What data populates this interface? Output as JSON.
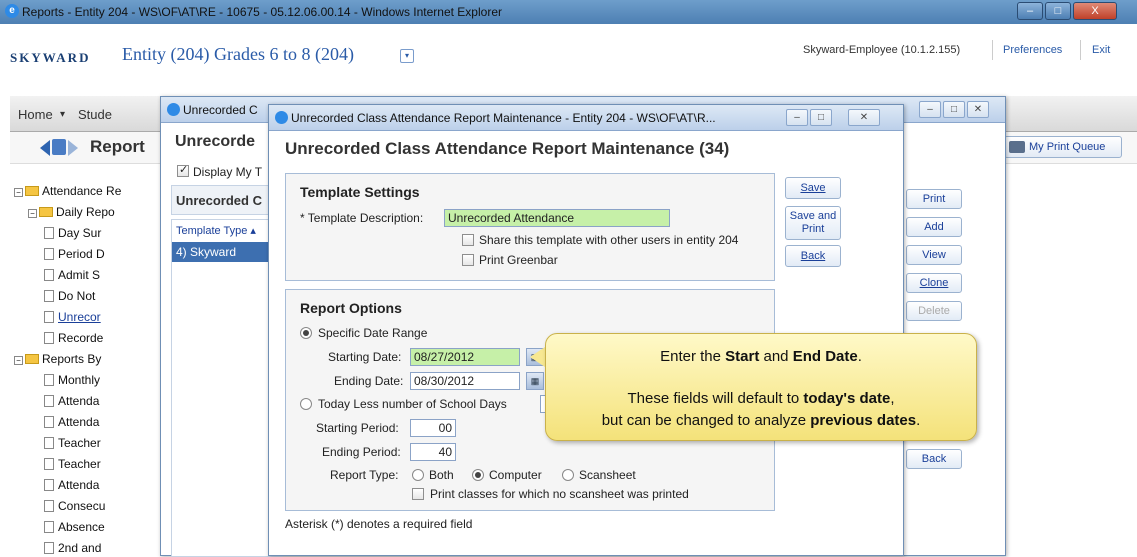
{
  "browser": {
    "title": "Reports - Entity 204 - WS\\OF\\AT\\RE - 10675 - 05.12.06.00.14 - Windows Internet Explorer",
    "controls": {
      "minimize": "–",
      "maximize": "□",
      "close": "X"
    }
  },
  "header": {
    "logo": "SKYWARD",
    "entity": "Entity (204) Grades 6 to 8 (204)",
    "entity_dropdown_glyph": "▾",
    "user": "Skyward-Employee (10.1.2.155)",
    "preferences": "Preferences",
    "exit": "Exit"
  },
  "nav": {
    "home": "Home",
    "home_arrow": "▾",
    "student": "Stude",
    "reports_title": "Report",
    "print_queue": "My Print Queue"
  },
  "tree": {
    "items": [
      {
        "text": "Attendance Re",
        "type": "folder",
        "pm": "−"
      },
      {
        "text": "Daily Repo",
        "type": "folder",
        "pm": "−"
      },
      {
        "text": "Day Sur",
        "type": "doc"
      },
      {
        "text": "Period D",
        "type": "doc"
      },
      {
        "text": "Admit S",
        "type": "doc"
      },
      {
        "text": "Do Not",
        "type": "doc"
      },
      {
        "text": "Unrecor",
        "type": "doc",
        "link": true
      },
      {
        "text": "Recorde",
        "type": "doc"
      },
      {
        "text": "Reports By",
        "type": "folder",
        "pm": "−"
      },
      {
        "text": "Monthly",
        "type": "doc"
      },
      {
        "text": "Attenda",
        "type": "doc"
      },
      {
        "text": "Attenda",
        "type": "doc"
      },
      {
        "text": "Teacher",
        "type": "doc"
      },
      {
        "text": "Teacher",
        "type": "doc"
      },
      {
        "text": "Attenda",
        "type": "doc"
      },
      {
        "text": "Consecu",
        "type": "doc"
      },
      {
        "text": "Absence",
        "type": "doc"
      },
      {
        "text": "2nd and",
        "type": "doc"
      }
    ]
  },
  "mid_window": {
    "title": "Unrecorded C",
    "heading": "Unrecorde",
    "display_my": "Display My T",
    "subheading": "Unrecorded C",
    "col_header": "Template Type ▴",
    "selected_row": "4) Skyward",
    "buttons": [
      "Print",
      "Add",
      "View",
      "Clone",
      "Delete",
      "Back"
    ]
  },
  "dialog": {
    "title": "Unrecorded Class Attendance Report Maintenance - Entity 204 - WS\\OF\\AT\\R...",
    "heading": "Unrecorded Class Attendance Report Maintenance (34)",
    "template_settings": {
      "title": "Template Settings",
      "desc_label": "* Template Description:",
      "desc_value": "Unrecorded Attendance",
      "share_label": "Share this template with other users in entity 204",
      "greenbar_label": "Print Greenbar"
    },
    "buttons": {
      "save": "Save",
      "save_print_1": "Save and",
      "save_print_2": "Print",
      "back": "Back"
    },
    "report_options": {
      "title": "Report Options",
      "specific_range": "Specific Date Range",
      "start_label": "Starting Date:",
      "start_value": "08/27/2012",
      "end_label": "Ending Date:",
      "end_value": "08/30/2012",
      "today_less": "Today Less number of School Days",
      "start_period_label": "Starting Period:",
      "start_period_value": "00",
      "end_period_label": "Ending Period:",
      "end_period_value": "40",
      "report_type_label": "Report Type:",
      "type_both": "Both",
      "type_computer": "Computer",
      "type_scansheet": "Scansheet",
      "print_classes": "Print classes for which no scansheet was printed"
    },
    "footnote": "Asterisk (*) denotes a required field"
  },
  "callout": {
    "line1_a": "Enter the ",
    "line1_b": "Start",
    "line1_c": " and ",
    "line1_d": "End Date",
    "line1_e": ".",
    "line2_a": "These fields will default to ",
    "line2_b": "today's date",
    "line2_c": ",",
    "line3_a": "but can be changed to analyze ",
    "line3_b": "previous dates",
    "line3_c": "."
  }
}
